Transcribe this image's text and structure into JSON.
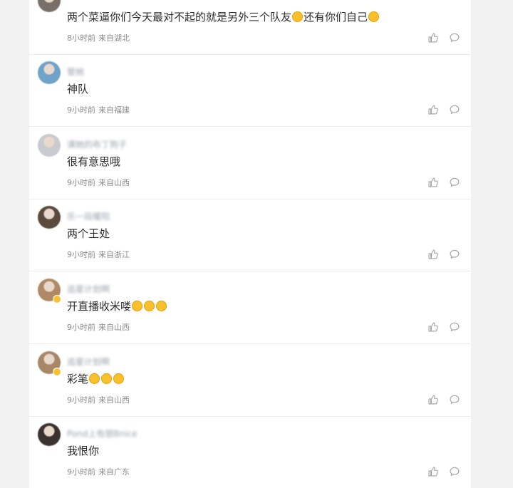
{
  "comments": [
    {
      "username": "",
      "avatar_color": "#7a6f68",
      "verified": false,
      "text": "两个菜逼你们今天最对不起的就是另外三个队友",
      "emoji_after_text": 1,
      "text2": "还有你们自己",
      "emoji_after_text2": 1,
      "time": "8小时前",
      "location": "来自湖北",
      "like_icon": "thumbs-up-icon",
      "reply_icon": "comment-bubble-icon"
    },
    {
      "username": "管她",
      "avatar_color": "#6fa3c8",
      "verified": false,
      "text": "神队",
      "emoji_after_text": 0,
      "text2": "",
      "emoji_after_text2": 0,
      "time": "9小时前",
      "location": "来自福建",
      "like_icon": "thumbs-up-icon",
      "reply_icon": "comment-bubble-icon"
    },
    {
      "username": "课她的布丁狗子",
      "avatar_color": "#c9cbd0",
      "verified": false,
      "text": "很有意思哦",
      "emoji_after_text": 0,
      "text2": "",
      "emoji_after_text2": 0,
      "time": "9小时前",
      "location": "来自山西",
      "like_icon": "thumbs-up-icon",
      "reply_icon": "comment-bubble-icon"
    },
    {
      "username": "乐一段暖阳",
      "avatar_color": "#5a4a3c",
      "verified": false,
      "text": "两个王处",
      "emoji_after_text": 0,
      "text2": "",
      "emoji_after_text2": 0,
      "time": "9小时前",
      "location": "来自浙江",
      "like_icon": "thumbs-up-icon",
      "reply_icon": "comment-bubble-icon"
    },
    {
      "username": "追星计划啊",
      "avatar_color": "#b08866",
      "verified": true,
      "text": "开直播收米喽",
      "emoji_after_text": 3,
      "text2": "",
      "emoji_after_text2": 0,
      "time": "9小时前",
      "location": "来自山西",
      "like_icon": "thumbs-up-icon",
      "reply_icon": "comment-bubble-icon"
    },
    {
      "username": "追星计划啊",
      "avatar_color": "#a88668",
      "verified": true,
      "text": "彩笔",
      "emoji_after_text": 3,
      "text2": "",
      "emoji_after_text2": 0,
      "time": "9小时前",
      "location": "来自山西",
      "like_icon": "thumbs-up-icon",
      "reply_icon": "comment-bubble-icon"
    },
    {
      "username": "Pond上有朋Bnice",
      "avatar_color": "#3b3230",
      "verified": false,
      "text": "我恨你",
      "emoji_after_text": 0,
      "text2": "",
      "emoji_after_text2": 0,
      "time": "9小时前",
      "location": "来自广东",
      "like_icon": "thumbs-up-icon",
      "reply_icon": "comment-bubble-icon"
    }
  ],
  "colors": {
    "page_bg": "#f2f2f2",
    "card_bg": "#ffffff",
    "text": "#2b2b2b",
    "meta": "#8c8c8c",
    "icon": "#a9a9a9"
  }
}
